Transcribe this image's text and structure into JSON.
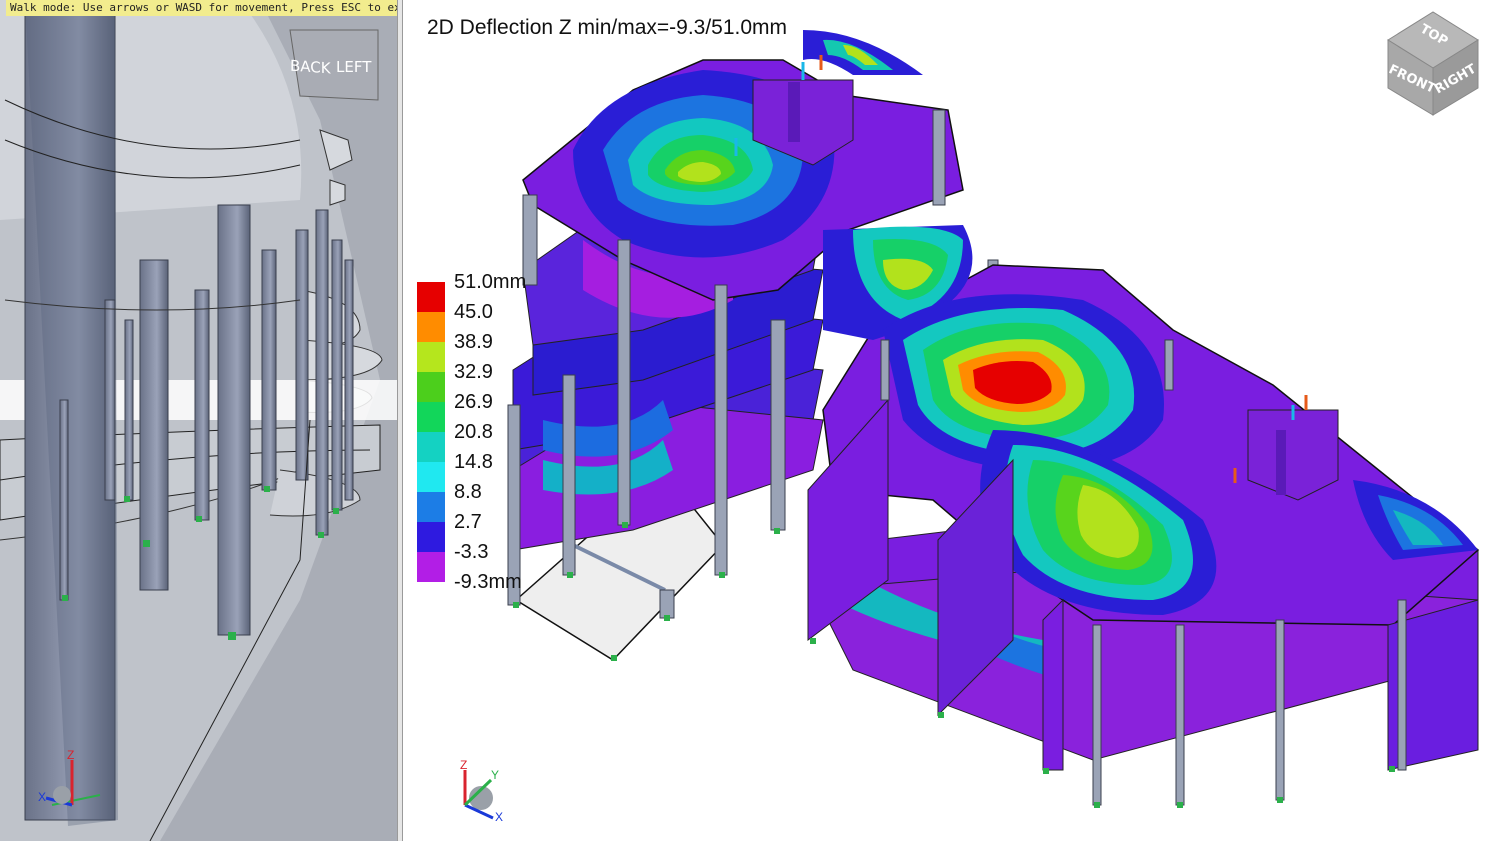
{
  "walk_mode": {
    "text": "Walk mode: Use arrows or WASD for movement, Press ESC to exit, Esc:UpPg"
  },
  "left_view": {
    "nav_labels": {
      "back": "BACK",
      "left": "LEFT"
    },
    "axis": {
      "z": "Z",
      "x": "X"
    }
  },
  "main_view": {
    "title": "2D Deflection Z min/max=-9.3/51.0mm",
    "view_cube": {
      "top": "TOP",
      "front": "FRONT",
      "right": "RIGHT"
    },
    "axis": {
      "z": "Z",
      "y": "Y",
      "x": "X"
    },
    "legend": {
      "labels": [
        "51.0mm",
        "45.0",
        "38.9",
        "32.9",
        "26.9",
        "20.8",
        "14.8",
        "8.8",
        "2.7",
        "-3.3",
        "-9.3mm"
      ],
      "colors": [
        "#e60000",
        "#ff8c00",
        "#b5e61d",
        "#4ccf1c",
        "#12d65a",
        "#14d2c2",
        "#20e8f0",
        "#1c7de6",
        "#2e1ae0",
        "#b21ee6",
        "#ff1aa0"
      ]
    }
  }
}
